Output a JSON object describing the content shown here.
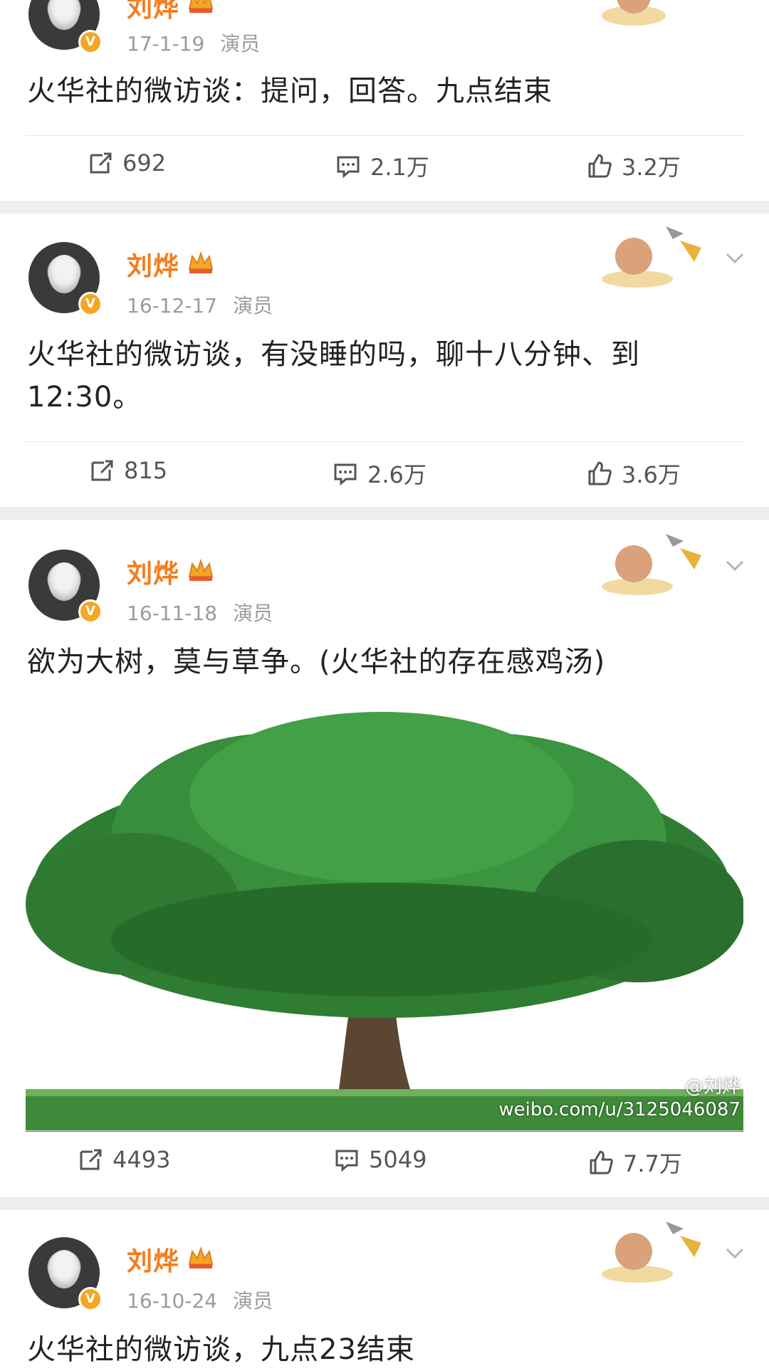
{
  "posts": [
    {
      "username": "刘烨",
      "date": "17-1-19",
      "tag": "演员",
      "text": "火华社的微访谈：提问，回答。九点结束",
      "repost": "692",
      "comment": "2.1万",
      "like": "3.2万"
    },
    {
      "username": "刘烨",
      "date": "16-12-17",
      "tag": "演员",
      "text": "火华社的微访谈，有没睡的吗，聊十八分钟、到 12:30。",
      "repost": "815",
      "comment": "2.6万",
      "like": "3.6万"
    },
    {
      "username": "刘烨",
      "date": "16-11-18",
      "tag": "演员",
      "text": "欲为大树，莫与草争。(火华社的存在感鸡汤)",
      "repost": "4493",
      "comment": "5049",
      "like": "7.7万",
      "image_watermark_user": "@刘烨",
      "image_watermark_url": "weibo.com/u/3125046087"
    },
    {
      "username": "刘烨",
      "date": "16-10-24",
      "tag": "演员",
      "text": "火华社的微访谈，九点23结束"
    }
  ],
  "icons": {
    "verified": "v-badge-icon",
    "crown": "crown-icon",
    "repost": "repost-icon",
    "comment": "comment-icon",
    "like": "like-icon",
    "more": "chevron-down-icon"
  },
  "colors": {
    "username": "#f47c1b",
    "badge": "#f5a623",
    "meta": "#9b9b9b",
    "separator": "#eeeeee"
  }
}
